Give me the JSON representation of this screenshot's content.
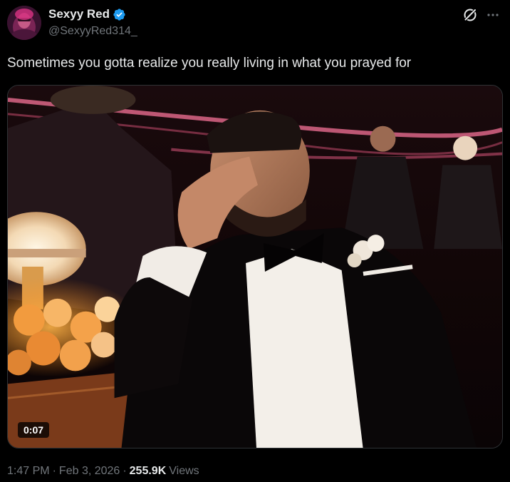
{
  "author": {
    "display_name": "Sexyy Red",
    "handle": "@SexyyRed314_",
    "verified": true,
    "avatar_icon": "avatar-image"
  },
  "header_actions": {
    "grok_icon": "grok-icon",
    "more_icon": "more-icon"
  },
  "tweet": {
    "text": "Sometimes you gotta realize you really living in what you prayed for"
  },
  "media": {
    "type": "video",
    "duration": "0:07"
  },
  "meta": {
    "time": "1:47 PM",
    "separator": "·",
    "date": "Feb 3, 2026",
    "views_count": "255.9K",
    "views_label": "Views"
  },
  "colors": {
    "background": "#000000",
    "primary_text": "#e7e9ea",
    "secondary_text": "#71767b",
    "verified_blue": "#1d9bf0",
    "border": "#2f3336"
  }
}
